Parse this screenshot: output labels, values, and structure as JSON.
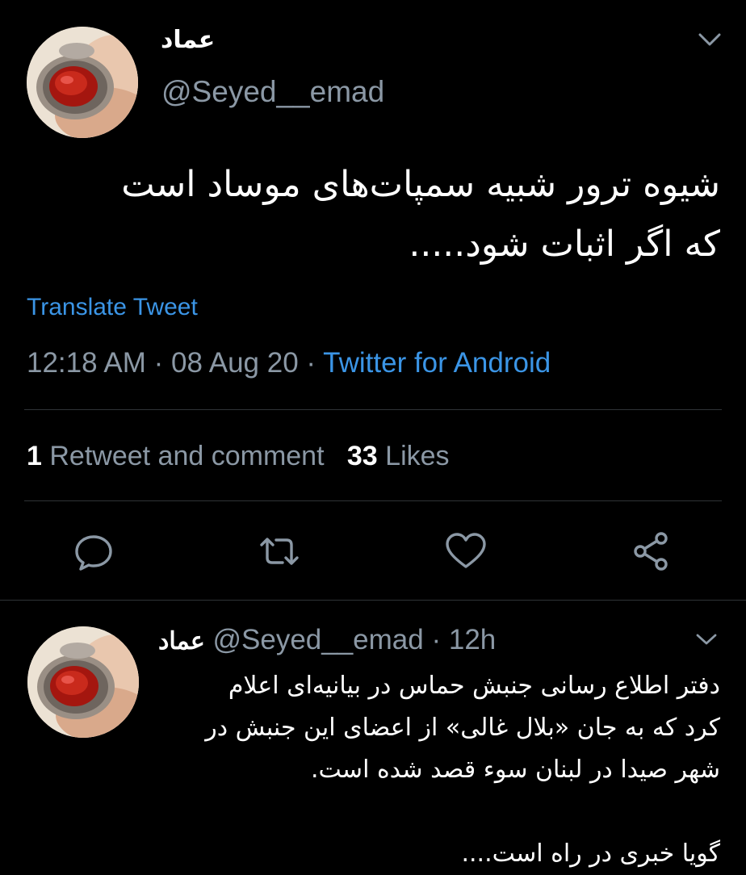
{
  "tweet": {
    "display_name": "عماد",
    "handle": "@Seyed__emad",
    "text_lines": [
      "شیوه ترور شبیه سمپات‌های موساد است",
      "که اگر اثبات شود....."
    ],
    "translate_label": "Translate Tweet",
    "time": "12:18 AM",
    "date": "08 Aug 20",
    "separator": "·",
    "source": "Twitter for Android",
    "retweets_count": "1",
    "retweets_label": "Retweet and comment",
    "likes_count": "33",
    "likes_label": "Likes",
    "icons": {
      "menu": "chevron-down-icon",
      "avatar": "ring-photo-avatar",
      "reply": "comment-bubble-icon",
      "retweet": "retweet-icon",
      "like": "heart-icon",
      "share": "share-icon"
    }
  },
  "reply": {
    "display_name": "عماد",
    "handle": "@Seyed__emad",
    "separator": "·",
    "age": "12h",
    "text_lines": [
      "دفتر اطلاع رسانی جنبش حماس در بیانیه‌ای اعلام",
      "کرد که به جان «بلال غالی» از اعضای این جنبش در",
      "شهر صیدا در لبنان سوء قصد شده است.",
      "",
      "گویا خبری در راه است...."
    ]
  },
  "colors": {
    "background": "#000000",
    "text": "#ffffff",
    "secondary": "#8b98a5",
    "link": "#3b95e6",
    "divider": "#2f3336"
  }
}
